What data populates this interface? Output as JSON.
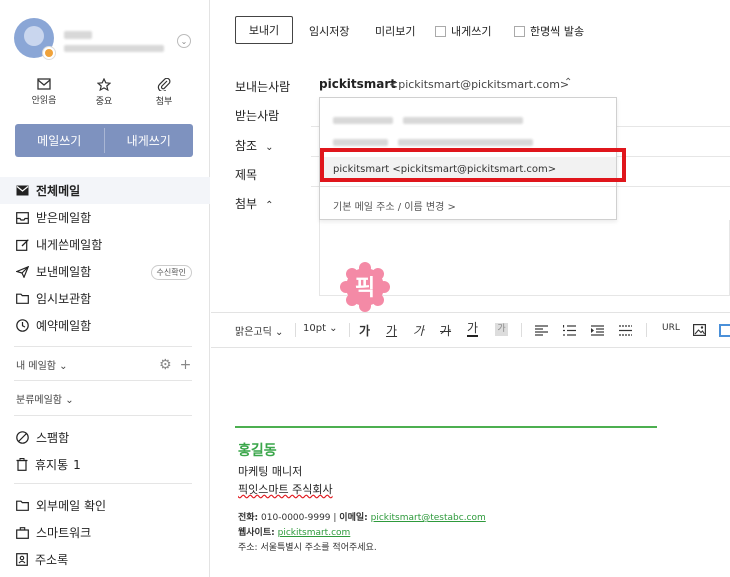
{
  "sidebar": {
    "quick_actions": [
      {
        "label": "안읽음",
        "icon": "envelope-icon"
      },
      {
        "label": "중요",
        "icon": "star-icon"
      },
      {
        "label": "첨부",
        "icon": "paperclip-icon"
      }
    ],
    "compose_label": "메일쓰기",
    "self_compose_label": "내게쓰기",
    "mailboxes": [
      {
        "label": "전체메일",
        "icon": "all-mail-icon"
      },
      {
        "label": "받은메일함",
        "icon": "inbox-icon"
      },
      {
        "label": "내게쓴메일함",
        "icon": "self-mail-icon"
      },
      {
        "label": "보낸메일함",
        "icon": "sent-icon",
        "badge": "수신확인"
      },
      {
        "label": "임시보관함",
        "icon": "drafts-icon"
      },
      {
        "label": "예약메일함",
        "icon": "scheduled-icon"
      }
    ],
    "my_mailbox_label": "내 메일함",
    "category_label": "분류메일함",
    "spam_label": "스팸함",
    "trash_label": "휴지통",
    "trash_count": "1",
    "external_label": "외부메일 확인",
    "smartwork_label": "스마트워크",
    "contacts_label": "주소록"
  },
  "toolbar": {
    "send": "보내기",
    "save_draft": "임시저장",
    "preview": "미리보기",
    "to_self": "내게쓰기",
    "individual_send": "한명씩 발송"
  },
  "fields": {
    "from_label": "보내는사람",
    "to_label": "받는사람",
    "cc_label": "참조",
    "subject_label": "제목",
    "attach_label": "첨부",
    "sender_name": "pickitsmart",
    "sender_address": "<pickitsmart@pickitsmart.com>"
  },
  "dropdown": {
    "selected": "pickitsmart <pickitsmart@pickitsmart.com>",
    "footer": "기본 메일 주소 / 이름 변경 >"
  },
  "sticker_text": "픽",
  "editor": {
    "font": "맑은고딕",
    "size": "10pt",
    "url_label": "URL"
  },
  "signature": {
    "name": "홍길동",
    "title": "마케팅 매니저",
    "company": "픽잇스마트 주식회사",
    "phone_label": "전화:",
    "phone": "010-0000-9999",
    "email_label": "이메일:",
    "email": "pickitsmart@testabc.com",
    "website_label": "웹사이트:",
    "website": "pickitsmart.com",
    "address_label": "주소:",
    "address": "서울특별시 주소를 적어주세요."
  },
  "colors": {
    "accent": "#7e92bf",
    "highlight": "#e0161c",
    "signature_green": "#3aa64a"
  }
}
